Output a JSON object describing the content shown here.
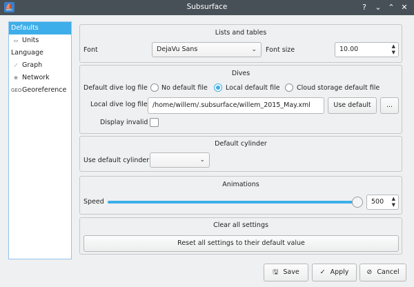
{
  "window": {
    "title": "Subsurface",
    "help_glyph": "?",
    "min_glyph": "⌄",
    "max_glyph": "⌃",
    "close_glyph": "✕"
  },
  "sidebar": {
    "items": [
      {
        "label": "Defaults",
        "icon": "",
        "selected": true
      },
      {
        "label": "Units",
        "icon": "units-icon"
      },
      {
        "label": "Language",
        "icon": ""
      },
      {
        "label": "Graph",
        "icon": "graph-icon"
      },
      {
        "label": "Network",
        "icon": "network-icon"
      },
      {
        "label": "Georeference",
        "icon": "geo-icon"
      }
    ]
  },
  "lists": {
    "title": "Lists and tables",
    "font_label": "Font",
    "font_value": "DejaVu Sans",
    "font_size_label": "Font size",
    "font_size_value": "10.00"
  },
  "dives": {
    "title": "Dives",
    "default_log_label": "Default dive log file",
    "opt_none": "No default file",
    "opt_local": "Local default file",
    "opt_cloud": "Cloud storage default file",
    "selected_option": "Local default file",
    "local_log_label": "Local dive log file",
    "local_log_value": "/home/willem/.subsurface/willem_2015_May.xml",
    "use_default_label": "Use default",
    "browse_label": "...",
    "display_invalid_label": "Display invalid",
    "display_invalid_checked": false
  },
  "cylinder": {
    "title": "Default cylinder",
    "use_default_label": "Use default cylinder",
    "value": ""
  },
  "animations": {
    "title": "Animations",
    "speed_label": "Speed",
    "speed_value": "500",
    "speed_fraction": 1.0
  },
  "clear": {
    "title": "Clear all settings",
    "reset_label": "Reset all settings to their default value"
  },
  "footer": {
    "save_label": "Save",
    "apply_label": "Apply",
    "cancel_label": "Cancel"
  }
}
